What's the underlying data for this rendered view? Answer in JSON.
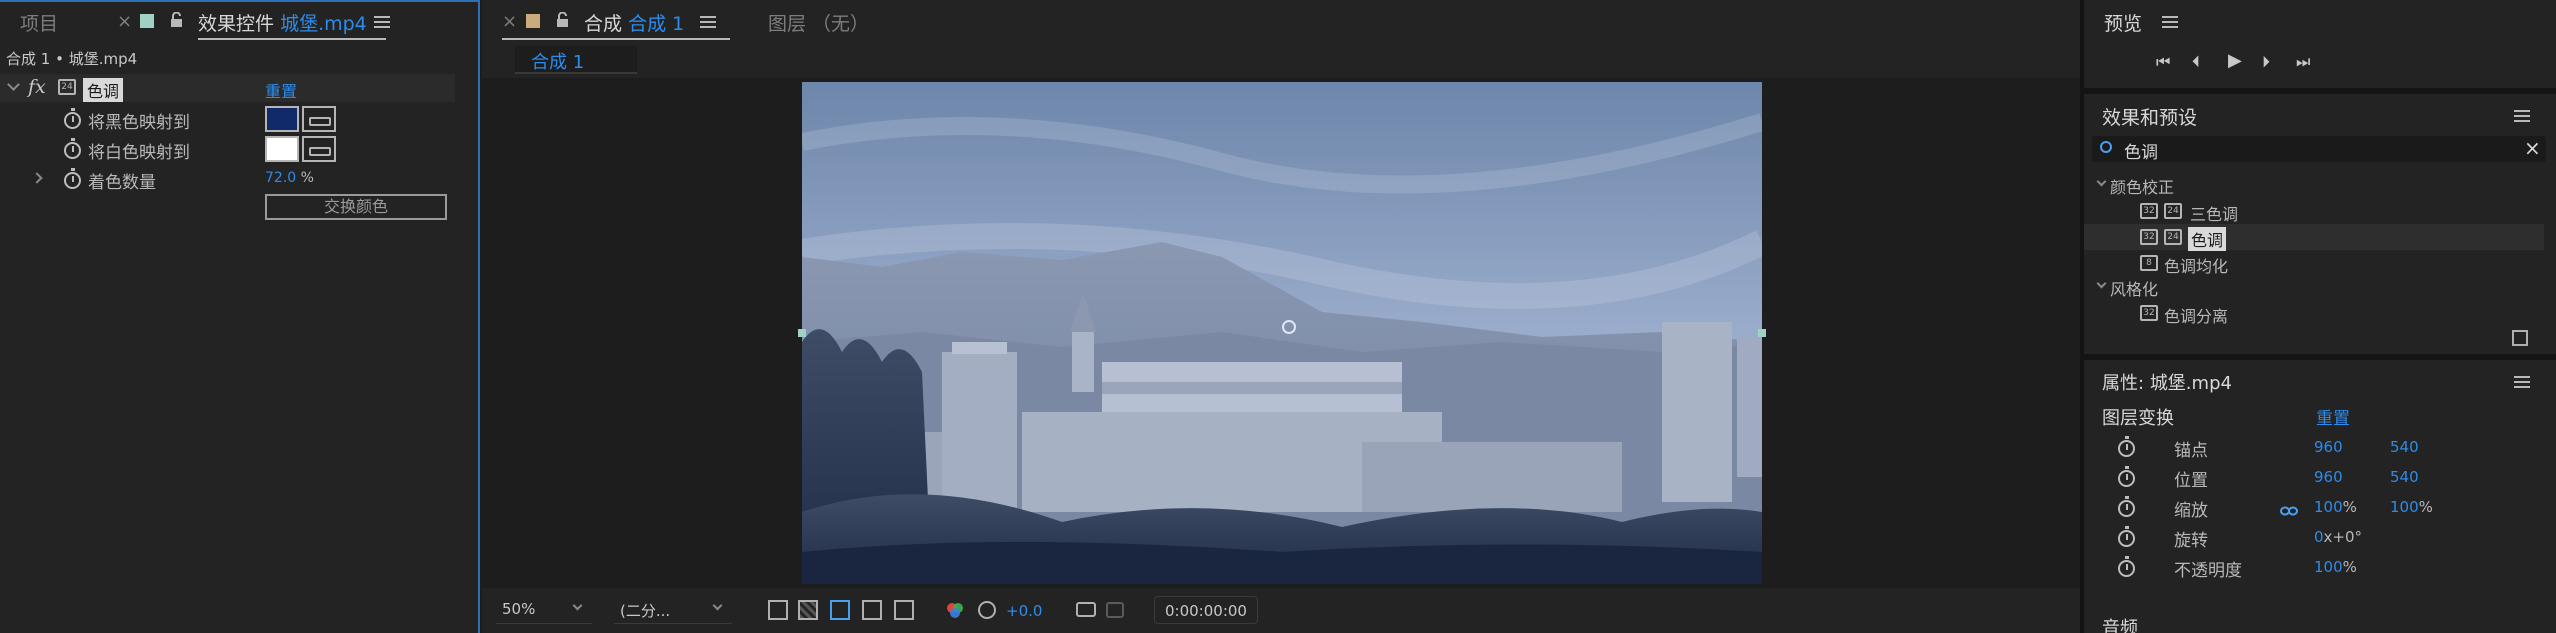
{
  "left_panel": {
    "tab_project": "项目",
    "tab_effect_prefix": "效果控件",
    "tab_effect_file": "城堡.mp4",
    "breadcrumb": "合成 1 • 城堡.mp4",
    "fx_label": "fx",
    "effect_name": "色调",
    "reset": "重置",
    "props": [
      {
        "label": "将黑色映射到",
        "color": "#102a6a"
      },
      {
        "label": "将白色映射到",
        "color": "#ffffff"
      },
      {
        "label": "着色数量",
        "value": "72.0",
        "unit": "%"
      }
    ],
    "swap_button": "交换颜色"
  },
  "comp_panel": {
    "tab_comp_prefix": "合成",
    "tab_comp_name": "合成 1",
    "tab_layer": "图层 （无）",
    "breadcrumb_tab": "合成 1",
    "zoom": "50%",
    "resolution": "(二分...",
    "exposure": "+0.0",
    "timecode": "0:00:00:00"
  },
  "preview_panel": {
    "title": "预览"
  },
  "effects_panel": {
    "title": "效果和预设",
    "search_value": "色调",
    "groups": [
      {
        "name": "颜色校正",
        "items": [
          "三色调",
          "色调",
          "色调均化"
        ]
      },
      {
        "name": "风格化",
        "items": [
          "色调分离"
        ]
      }
    ]
  },
  "props_panel": {
    "title_prefix": "属性:",
    "title_file": "城堡.mp4",
    "section": "图层变换",
    "reset": "重置",
    "rows": [
      {
        "label": "锚点",
        "v1": "960",
        "v2": "540"
      },
      {
        "label": "位置",
        "v1": "960",
        "v2": "540"
      },
      {
        "label": "缩放",
        "v1": "100",
        "u1": "%",
        "v2": "100",
        "u2": "%"
      },
      {
        "label": "旋转",
        "v1": "0",
        "u1": "x+0",
        "deg": "°"
      },
      {
        "label": "不透明度",
        "v1": "100",
        "u1": "%"
      }
    ],
    "audio": "音频"
  },
  "colors": {
    "accent": "#2d8ceb",
    "panel_bg": "#232323",
    "app_bg": "#1d1d1d"
  }
}
